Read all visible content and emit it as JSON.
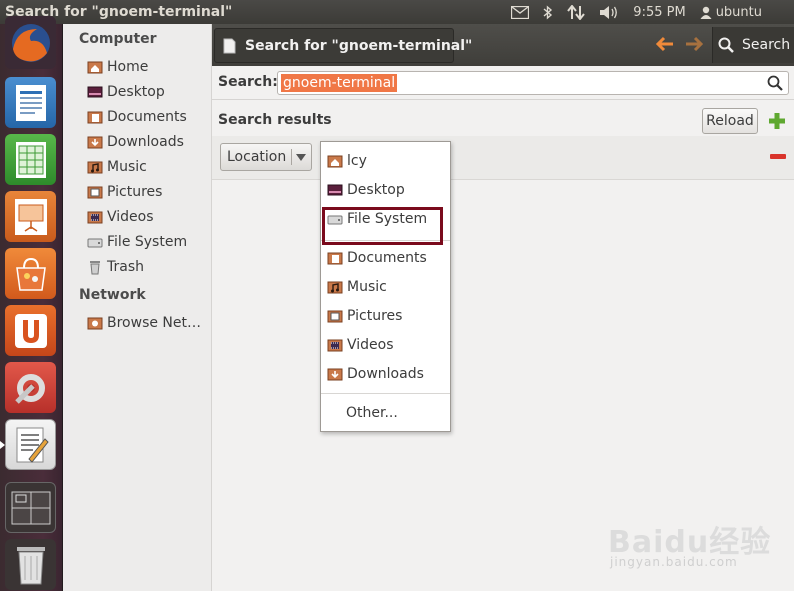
{
  "top_panel": {
    "window_title": "Search for \"gnoem-terminal\"",
    "clock": "9:55 PM",
    "user": "ubuntu"
  },
  "sidebar": {
    "computer_header": "Computer",
    "computer_items": [
      {
        "label": "Home",
        "icon": "home-folder-icon"
      },
      {
        "label": "Desktop",
        "icon": "desktop-icon"
      },
      {
        "label": "Documents",
        "icon": "documents-folder-icon"
      },
      {
        "label": "Downloads",
        "icon": "downloads-folder-icon"
      },
      {
        "label": "Music",
        "icon": "music-folder-icon"
      },
      {
        "label": "Pictures",
        "icon": "pictures-folder-icon"
      },
      {
        "label": "Videos",
        "icon": "videos-folder-icon"
      },
      {
        "label": "File System",
        "icon": "drive-icon"
      },
      {
        "label": "Trash",
        "icon": "trash-icon"
      }
    ],
    "network_header": "Network",
    "network_items": [
      {
        "label": "Browse Net…",
        "icon": "network-icon"
      }
    ]
  },
  "toolbar": {
    "tab_title": "Search for \"gnoem-terminal\"",
    "search_button": "Search"
  },
  "search": {
    "label": "Search:",
    "value": "gnoem-terminal"
  },
  "results": {
    "title": "Search results",
    "reload_label": "Reload",
    "location_label": "Location"
  },
  "dropdown": {
    "items": [
      {
        "label": "lcy",
        "icon": "home-folder-icon"
      },
      {
        "label": "Desktop",
        "icon": "desktop-icon"
      },
      {
        "label": "File System",
        "icon": "drive-icon"
      },
      {
        "label": "Documents",
        "icon": "documents-folder-icon"
      },
      {
        "label": "Music",
        "icon": "music-folder-icon"
      },
      {
        "label": "Pictures",
        "icon": "pictures-folder-icon"
      },
      {
        "label": "Videos",
        "icon": "videos-folder-icon"
      },
      {
        "label": "Downloads",
        "icon": "downloads-folder-icon"
      }
    ],
    "other_label": "Other..."
  },
  "watermark": {
    "brand": "Baidu经验",
    "url": "jingyan.baidu.com"
  },
  "colors": {
    "accent_orange": "#f07746",
    "highlight_box": "#7a0a1c",
    "panel_dark": "#3c3b37"
  }
}
